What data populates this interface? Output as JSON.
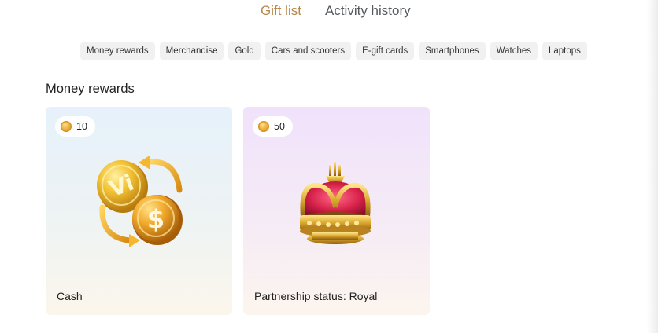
{
  "tabs": [
    {
      "label": "Gift list",
      "active": true
    },
    {
      "label": "Activity history",
      "active": false
    }
  ],
  "categories": [
    "Money rewards",
    "Merchandise",
    "Gold",
    "Cars and scooters",
    "E-gift cards",
    "Smartphones",
    "Watches",
    "Laptops"
  ],
  "section": {
    "title": "Money rewards"
  },
  "cards": [
    {
      "points": "10",
      "label": "Cash",
      "image": "gold-coins-exchange-icon"
    },
    {
      "points": "50",
      "label": "Partnership status: Royal",
      "image": "gold-crown-icon"
    }
  ],
  "colors": {
    "accent": "#b8874a",
    "chip_bg": "#f1f1f1",
    "coin_gold": "#e4a42a"
  }
}
